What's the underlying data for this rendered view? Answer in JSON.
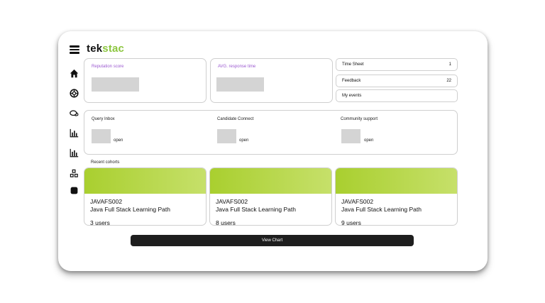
{
  "brand": {
    "logo_part1": "tek",
    "logo_part2": "stac",
    "accent": "#8cc63f"
  },
  "sidebar": {
    "icons": [
      "home-icon",
      "lifebuoy-icon",
      "chat-icon",
      "bar-chart-icon",
      "bar-chart-icon",
      "cubes-icon",
      "square-icon"
    ]
  },
  "metrics": {
    "reputation_label": "Reputation score",
    "response_label": "AVG. response time"
  },
  "stats": [
    {
      "label": "Time Sheet",
      "value": "1"
    },
    {
      "label": "Feedback",
      "value": "22"
    },
    {
      "label": "My events",
      "value": ""
    }
  ],
  "inbox": {
    "query": {
      "label": "Query Inbox",
      "status": "open"
    },
    "candidate": {
      "label": "Candidate Connect",
      "status": "open"
    },
    "community": {
      "label": "Community support",
      "status": "open"
    }
  },
  "recent_cohorts_label": "Recent cohorts",
  "cohorts": [
    {
      "code": "JAVAFS002",
      "name": "Java Full Stack Learning Path",
      "users": "3 users"
    },
    {
      "code": "JAVAFS002",
      "name": "Java Full Stack Learning Path",
      "users": "8 users"
    },
    {
      "code": "JAVAFS002",
      "name": "Java Full Stack Learning Path",
      "users": "9 users"
    }
  ],
  "view_chart_label": "View Chart"
}
